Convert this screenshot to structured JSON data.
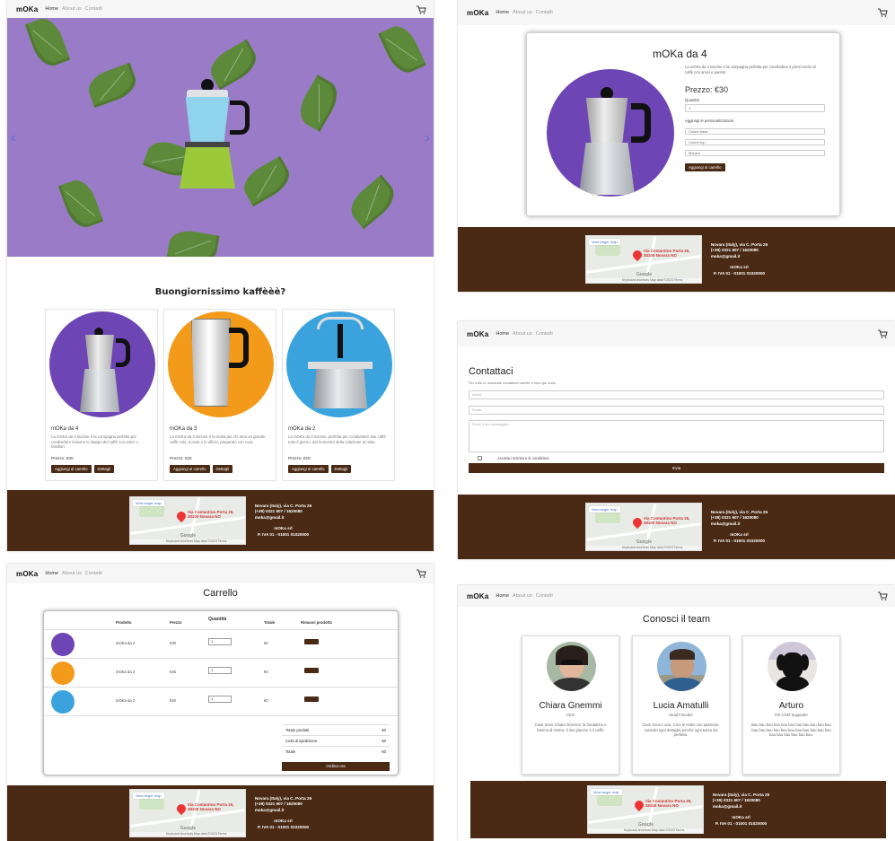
{
  "nav": {
    "brand": "mOKa",
    "home": "Home",
    "about": "About us",
    "contacts": "Contatti"
  },
  "footer": {
    "map_view_larger": "View larger map",
    "map_pin_label": "Via Costantino Porta 25, 28100 Novara NO",
    "map_google": "Google",
    "map_footer": "Keyboard shortcuts  Map data ©2023  Terms",
    "address": "Novara (Italy), via C. Porta 25",
    "phone": "(+39) 0321 607 / 1620080",
    "email": "moka@gmail.it",
    "piva_label": "mOKa srl",
    "piva": "P. IVA 01 - 01001 01020000"
  },
  "home": {
    "title": "Buongiornissimo kaffèèè?",
    "products": [
      {
        "name": "mOKa da 4",
        "desc": "La mOKa da 4 tazzine è la compagna perfetta per condividere insieme lo stappo del caffè con amici o familiari.",
        "price": "Prezzo: €30"
      },
      {
        "name": "mOKa da 3",
        "desc": "La mOKa da 3 tazzine è la moka per chi ama un grande caffè solo, a casa o in ufficio, preparato con cura.",
        "price": "Prezzo: €25"
      },
      {
        "name": "mOKa da 2",
        "desc": "La mOKa da 2 tazzine, perfetta per condividere due caffè tutto il giorno, dal momento della colazione al relax.",
        "price": "Prezzo: €20"
      }
    ],
    "add_label": "Aggiungi al carrello",
    "details_label": "Dettagli"
  },
  "detail": {
    "title": "mOKa da 4",
    "desc": "La mOKa da 4 tazzine è la compagna perfetta per condividere il primo sorso di caffè con amici e parenti.",
    "price": "Prezzo: €30",
    "qty_label": "Quantità",
    "qty_value": "1",
    "personalize_label": "Aggiungi le personalizzazioni",
    "options": [
      "Colore base",
      "Colore top",
      "Manico"
    ],
    "add_label": "Aggiungi al carrello"
  },
  "contact": {
    "title": "Contattaci",
    "subtitle": "Per tutte le domande contattaci tramite il form qui sotto",
    "name_ph": "Nome",
    "email_ph": "Email",
    "message_ph": "Scrivi il tuo messaggio...",
    "accept": "Accetta i termini e le condizioni",
    "submit": "Invia"
  },
  "cart": {
    "title": "Carrello",
    "headers": [
      "Prodotto",
      "Prezzo",
      "Quantità",
      "Totale",
      "Rimuovi prodotto"
    ],
    "rows": [
      {
        "name": "mOKa da 4",
        "price": "€30",
        "qty": "1",
        "total": "€0"
      },
      {
        "name": "mOKa da 3",
        "price": "€25",
        "qty": "1",
        "total": "€0"
      },
      {
        "name": "mOKa da 2",
        "price": "€20",
        "qty": "1",
        "total": "€0"
      }
    ],
    "summary": [
      {
        "label": "Totale prodotti",
        "value": "€0"
      },
      {
        "label": "Costi di spedizione",
        "value": "€0"
      },
      {
        "label": "Totale",
        "value": "€0"
      }
    ],
    "checkout": "Ordina ora"
  },
  "team": {
    "title": "Conosci il team",
    "members": [
      {
        "name": "Chiara Gnemmi",
        "role": "CEO",
        "desc": "Ciao! Sono Chiara Gnemmi, la fondatrice e l'anima di mOKa: il mio piacere è il caffè."
      },
      {
        "name": "Lucia Amatulli",
        "role": "Head Founder",
        "desc": "Ciao! Sono Lucia. Creo le moke con passione, curando ogni dettaglio perché ogni tazza sia perfetta."
      },
      {
        "name": "Arturo",
        "role": "Pet Chief Supporter",
        "desc": "Bau bau bau bau bau bau bau bau bau bau bau bau bau bau bau bau bau bau bau bau bau bau bau bau bau bau bau bau."
      }
    ]
  }
}
